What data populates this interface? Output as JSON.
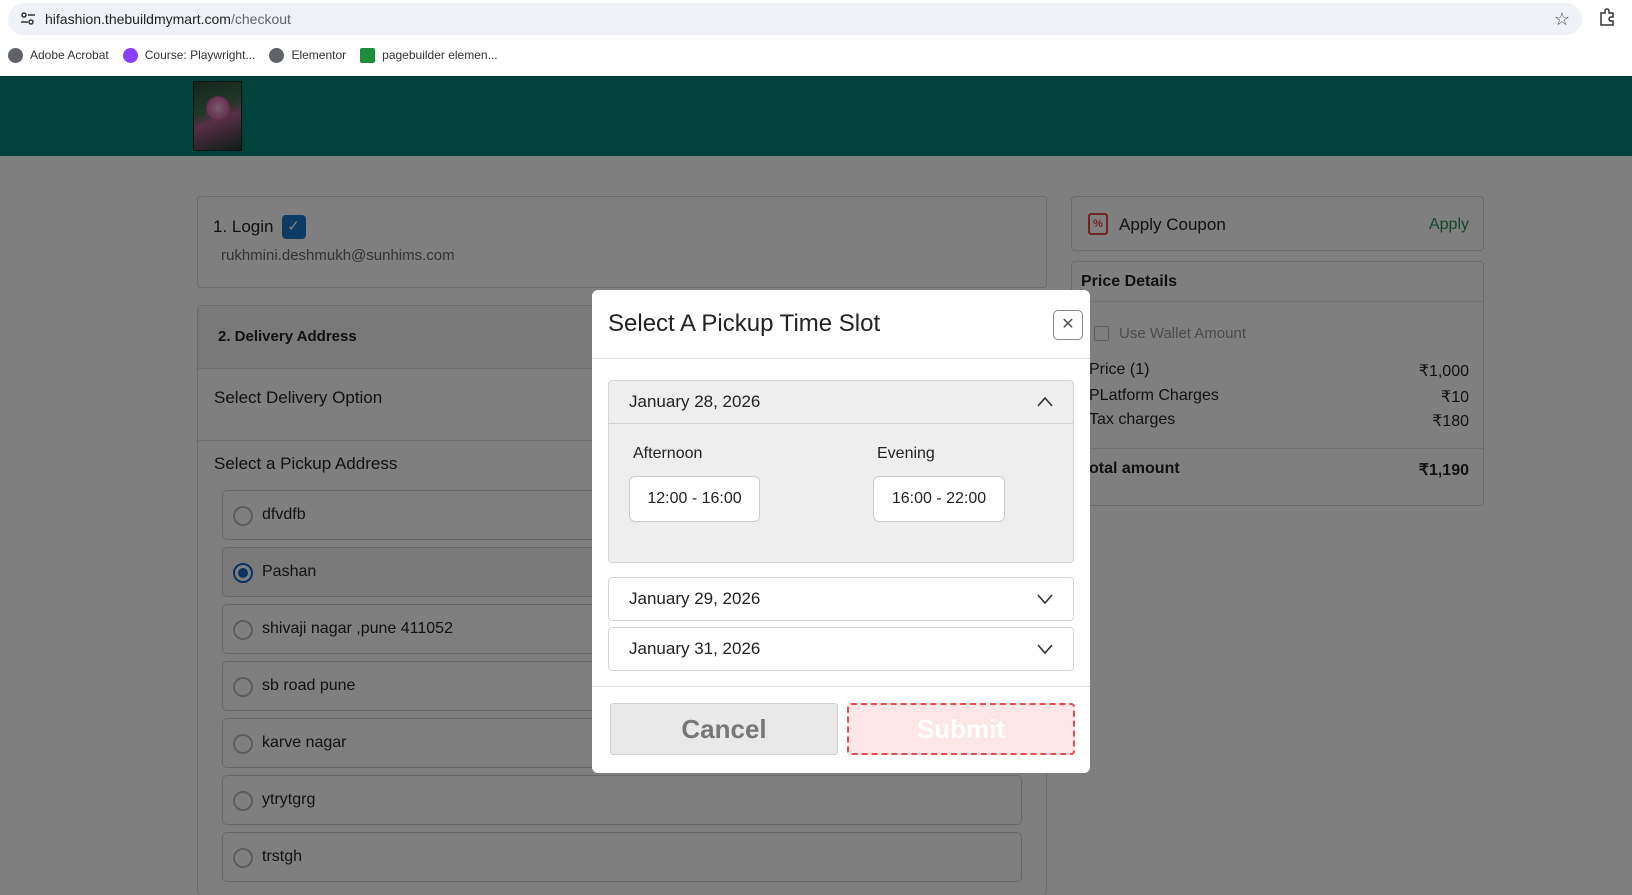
{
  "browser": {
    "url_domain": "hifashion.thebuildmymart.com",
    "url_path": "/checkout",
    "bookmarks": [
      {
        "label": "Adobe Acrobat",
        "icon": "globe-icon"
      },
      {
        "label": "Course: Playwright...",
        "icon": "course-icon"
      },
      {
        "label": "Elementor",
        "icon": "globe-icon"
      },
      {
        "label": "pagebuilder elemen...",
        "icon": "sheets-icon"
      }
    ]
  },
  "colors": {
    "header": "#008277",
    "accent_blue": "#1565c0",
    "apply_green": "#2e8b57",
    "submit_border": "#e74c4c"
  },
  "checkout": {
    "login": {
      "title": "1. Login",
      "email": "rukhmini.deshmukh@sunhims.com"
    },
    "delivery": {
      "title": "2. Delivery Address",
      "option_label": "Select Delivery Option",
      "pickup_label": "Select a Pickup Address",
      "addresses": [
        {
          "name": "dfvdfb",
          "selected": false
        },
        {
          "name": "Pashan",
          "selected": true
        },
        {
          "name": "shivaji nagar ,pune 411052",
          "selected": false
        },
        {
          "name": "sb road pune",
          "selected": false
        },
        {
          "name": "karve nagar",
          "selected": false
        },
        {
          "name": "ytrytgrg",
          "selected": false
        },
        {
          "name": "trstgh",
          "selected": false
        }
      ]
    }
  },
  "coupon": {
    "title": "Apply Coupon",
    "apply_label": "Apply"
  },
  "price": {
    "title": "Price Details",
    "wallet_label": "Use Wallet Amount",
    "rows": [
      {
        "label": "Price (1)",
        "value": "₹1,000"
      },
      {
        "label": "PLatform Charges",
        "value": "₹10"
      },
      {
        "label": "Tax charges",
        "value": "₹180"
      }
    ],
    "total_label": "otal amount",
    "total_value": "₹1,190"
  },
  "modal": {
    "title": "Select A Pickup Time Slot",
    "close_glyph": "✕",
    "dates": [
      {
        "label": "January 28, 2026",
        "expanded": true
      },
      {
        "label": "January 29, 2026",
        "expanded": false
      },
      {
        "label": "January 31, 2026",
        "expanded": false
      }
    ],
    "slots": {
      "afternoon_label": "Afternoon",
      "afternoon_time": "12:00 - 16:00",
      "evening_label": "Evening",
      "evening_time": "16:00 - 22:00"
    },
    "cancel_label": "Cancel",
    "submit_label": "Submit"
  }
}
